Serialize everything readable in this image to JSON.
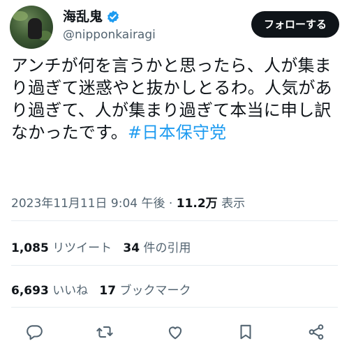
{
  "user": {
    "display_name": "海乱鬼",
    "handle": "@nipponkairagi",
    "follow_label": "フォローする"
  },
  "tweet": {
    "text": "アンチが何を言うかと思ったら、人が集まり過ぎて迷惑やと抜かしとるわ。人気があり過ぎて、人が集まり過ぎて本当に申し訳なかったです。",
    "hashtag": "#日本保守党"
  },
  "meta": {
    "timestamp": "2023年11月11日 9:04 午後",
    "separator": "·",
    "views_count": "11.2万",
    "views_label": "表示"
  },
  "stats": {
    "retweets_count": "1,085",
    "retweets_label": "リツイート",
    "quotes_count": "34",
    "quotes_label": "件の引用",
    "likes_count": "6,693",
    "likes_label": "いいね",
    "bookmarks_count": "17",
    "bookmarks_label": "ブックマーク"
  },
  "icons": {
    "verified": "verified-badge-icon",
    "reply": "reply-icon",
    "retweet": "retweet-icon",
    "like": "heart-icon",
    "bookmark": "bookmark-icon",
    "share": "share-icon"
  },
  "colors": {
    "text": "#0f1419",
    "secondary": "#536471",
    "accent": "#1d9bf0",
    "follow_bg": "#0f1419"
  }
}
